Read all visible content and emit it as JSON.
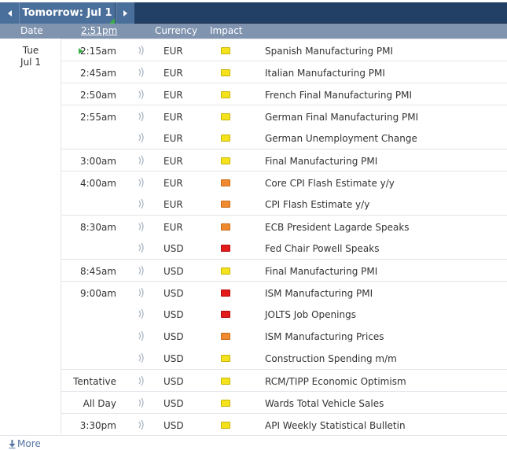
{
  "nav": {
    "prev_icon": "chevron-left-icon",
    "next_icon": "chevron-right-icon",
    "week_label": "Tomorrow: Jul 1"
  },
  "header": {
    "date": "Date",
    "time": "2:51pm",
    "currency": "Currency",
    "impact": "Impact"
  },
  "date": {
    "day": "Tue",
    "date": "Jul 1"
  },
  "impact_colors": {
    "yellow": "#f4e21c",
    "orange": "#f08a31",
    "red": "#e31b1b"
  },
  "events": [
    {
      "time": "2:15am",
      "currency": "EUR",
      "impact": "yellow",
      "title": "Spanish Manufacturing PMI",
      "next": true
    },
    {
      "time": "2:45am",
      "currency": "EUR",
      "impact": "yellow",
      "title": "Italian Manufacturing PMI"
    },
    {
      "time": "2:50am",
      "currency": "EUR",
      "impact": "yellow",
      "title": "French Final Manufacturing PMI"
    },
    {
      "time": "2:55am",
      "currency": "EUR",
      "impact": "yellow",
      "title": "German Final Manufacturing PMI"
    },
    {
      "time": "",
      "currency": "EUR",
      "impact": "yellow",
      "title": "German Unemployment Change"
    },
    {
      "time": "3:00am",
      "currency": "EUR",
      "impact": "yellow",
      "title": "Final Manufacturing PMI"
    },
    {
      "time": "4:00am",
      "currency": "EUR",
      "impact": "orange",
      "title": "Core CPI Flash Estimate y/y"
    },
    {
      "time": "",
      "currency": "EUR",
      "impact": "orange",
      "title": "CPI Flash Estimate y/y"
    },
    {
      "time": "8:30am",
      "currency": "EUR",
      "impact": "orange",
      "title": "ECB President Lagarde Speaks"
    },
    {
      "time": "",
      "currency": "USD",
      "impact": "red",
      "title": "Fed Chair Powell Speaks"
    },
    {
      "time": "8:45am",
      "currency": "USD",
      "impact": "yellow",
      "title": "Final Manufacturing PMI"
    },
    {
      "time": "9:00am",
      "currency": "USD",
      "impact": "red",
      "title": "ISM Manufacturing PMI"
    },
    {
      "time": "",
      "currency": "USD",
      "impact": "red",
      "title": "JOLTS Job Openings"
    },
    {
      "time": "",
      "currency": "USD",
      "impact": "orange",
      "title": "ISM Manufacturing Prices"
    },
    {
      "time": "",
      "currency": "USD",
      "impact": "yellow",
      "title": "Construction Spending m/m"
    },
    {
      "time": "Tentative",
      "currency": "USD",
      "impact": "yellow",
      "title": "RCM/TIPP Economic Optimism"
    },
    {
      "time": "All Day",
      "currency": "USD",
      "impact": "yellow",
      "title": "Wards Total Vehicle Sales"
    },
    {
      "time": "3:30pm",
      "currency": "USD",
      "impact": "yellow",
      "title": "API Weekly Statistical Bulletin"
    }
  ],
  "footer": {
    "more_label": "More",
    "more_icon": "download-arrow-icon"
  }
}
